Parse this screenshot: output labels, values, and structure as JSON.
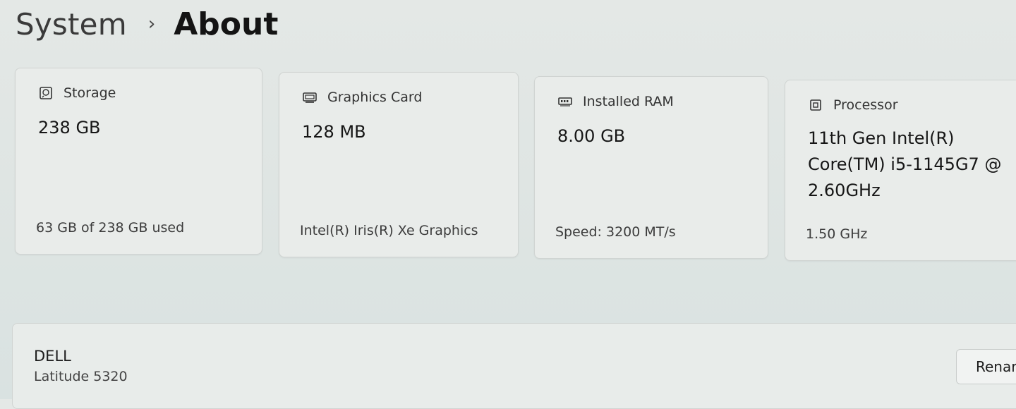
{
  "breadcrumb": {
    "parent": "System",
    "separator": "›",
    "current": "About"
  },
  "specs": {
    "storage": {
      "icon": "storage-icon",
      "title": "Storage",
      "value": "238 GB",
      "detail": "63 GB of 238 GB used"
    },
    "graphics": {
      "icon": "graphics-card-icon",
      "title": "Graphics Card",
      "value": "128 MB",
      "detail": "Intel(R) Iris(R) Xe Graphics"
    },
    "ram": {
      "icon": "ram-icon",
      "title": "Installed RAM",
      "value": "8.00 GB",
      "detail": "Speed: 3200 MT/s"
    },
    "processor": {
      "icon": "processor-icon",
      "title": "Processor",
      "value": "11th Gen Intel(R) Core(TM) i5-1145G7 @ 2.60GHz",
      "detail": "1.50 GHz"
    }
  },
  "device": {
    "manufacturer": "DELL",
    "model": "Latitude 5320",
    "rename_label": "Renar"
  }
}
